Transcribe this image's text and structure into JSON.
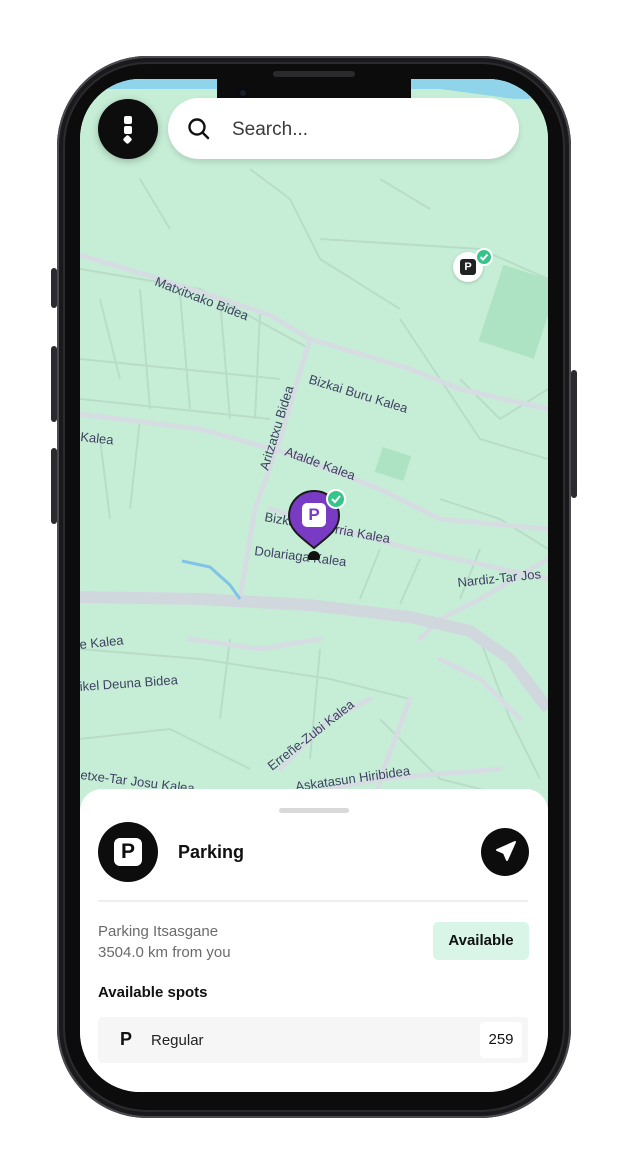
{
  "search": {
    "placeholder": "Search..."
  },
  "map": {
    "streets": [
      "Matxitxako Bidea",
      "Bizkai Buru Kalea",
      "Aritzatxu Bidea",
      "Atalde Kalea",
      "Bizkai Laurerria Kalea",
      "Dolariaga Kalea",
      "Kalea",
      "Nardiz-Tar Jos",
      "e Kalea",
      "ikel Deuna Bidea",
      "Erreñe-Zubi Kalea",
      "Askatasun Hiribidea",
      "etxe-Tar Josu Kalea"
    ],
    "marker_symbol": "P",
    "colors": {
      "map_bg": "#c6eed6",
      "marker": "#7a3bc4",
      "check": "#35c48a",
      "road": "#d5dde3"
    }
  },
  "sheet": {
    "title": "Parking",
    "place_name": "Parking Itsasgane",
    "distance": "3504.0 km from you",
    "status": "Available",
    "spots_title": "Available spots",
    "spots": [
      {
        "icon": "P",
        "label": "Regular",
        "count": "259"
      }
    ]
  }
}
